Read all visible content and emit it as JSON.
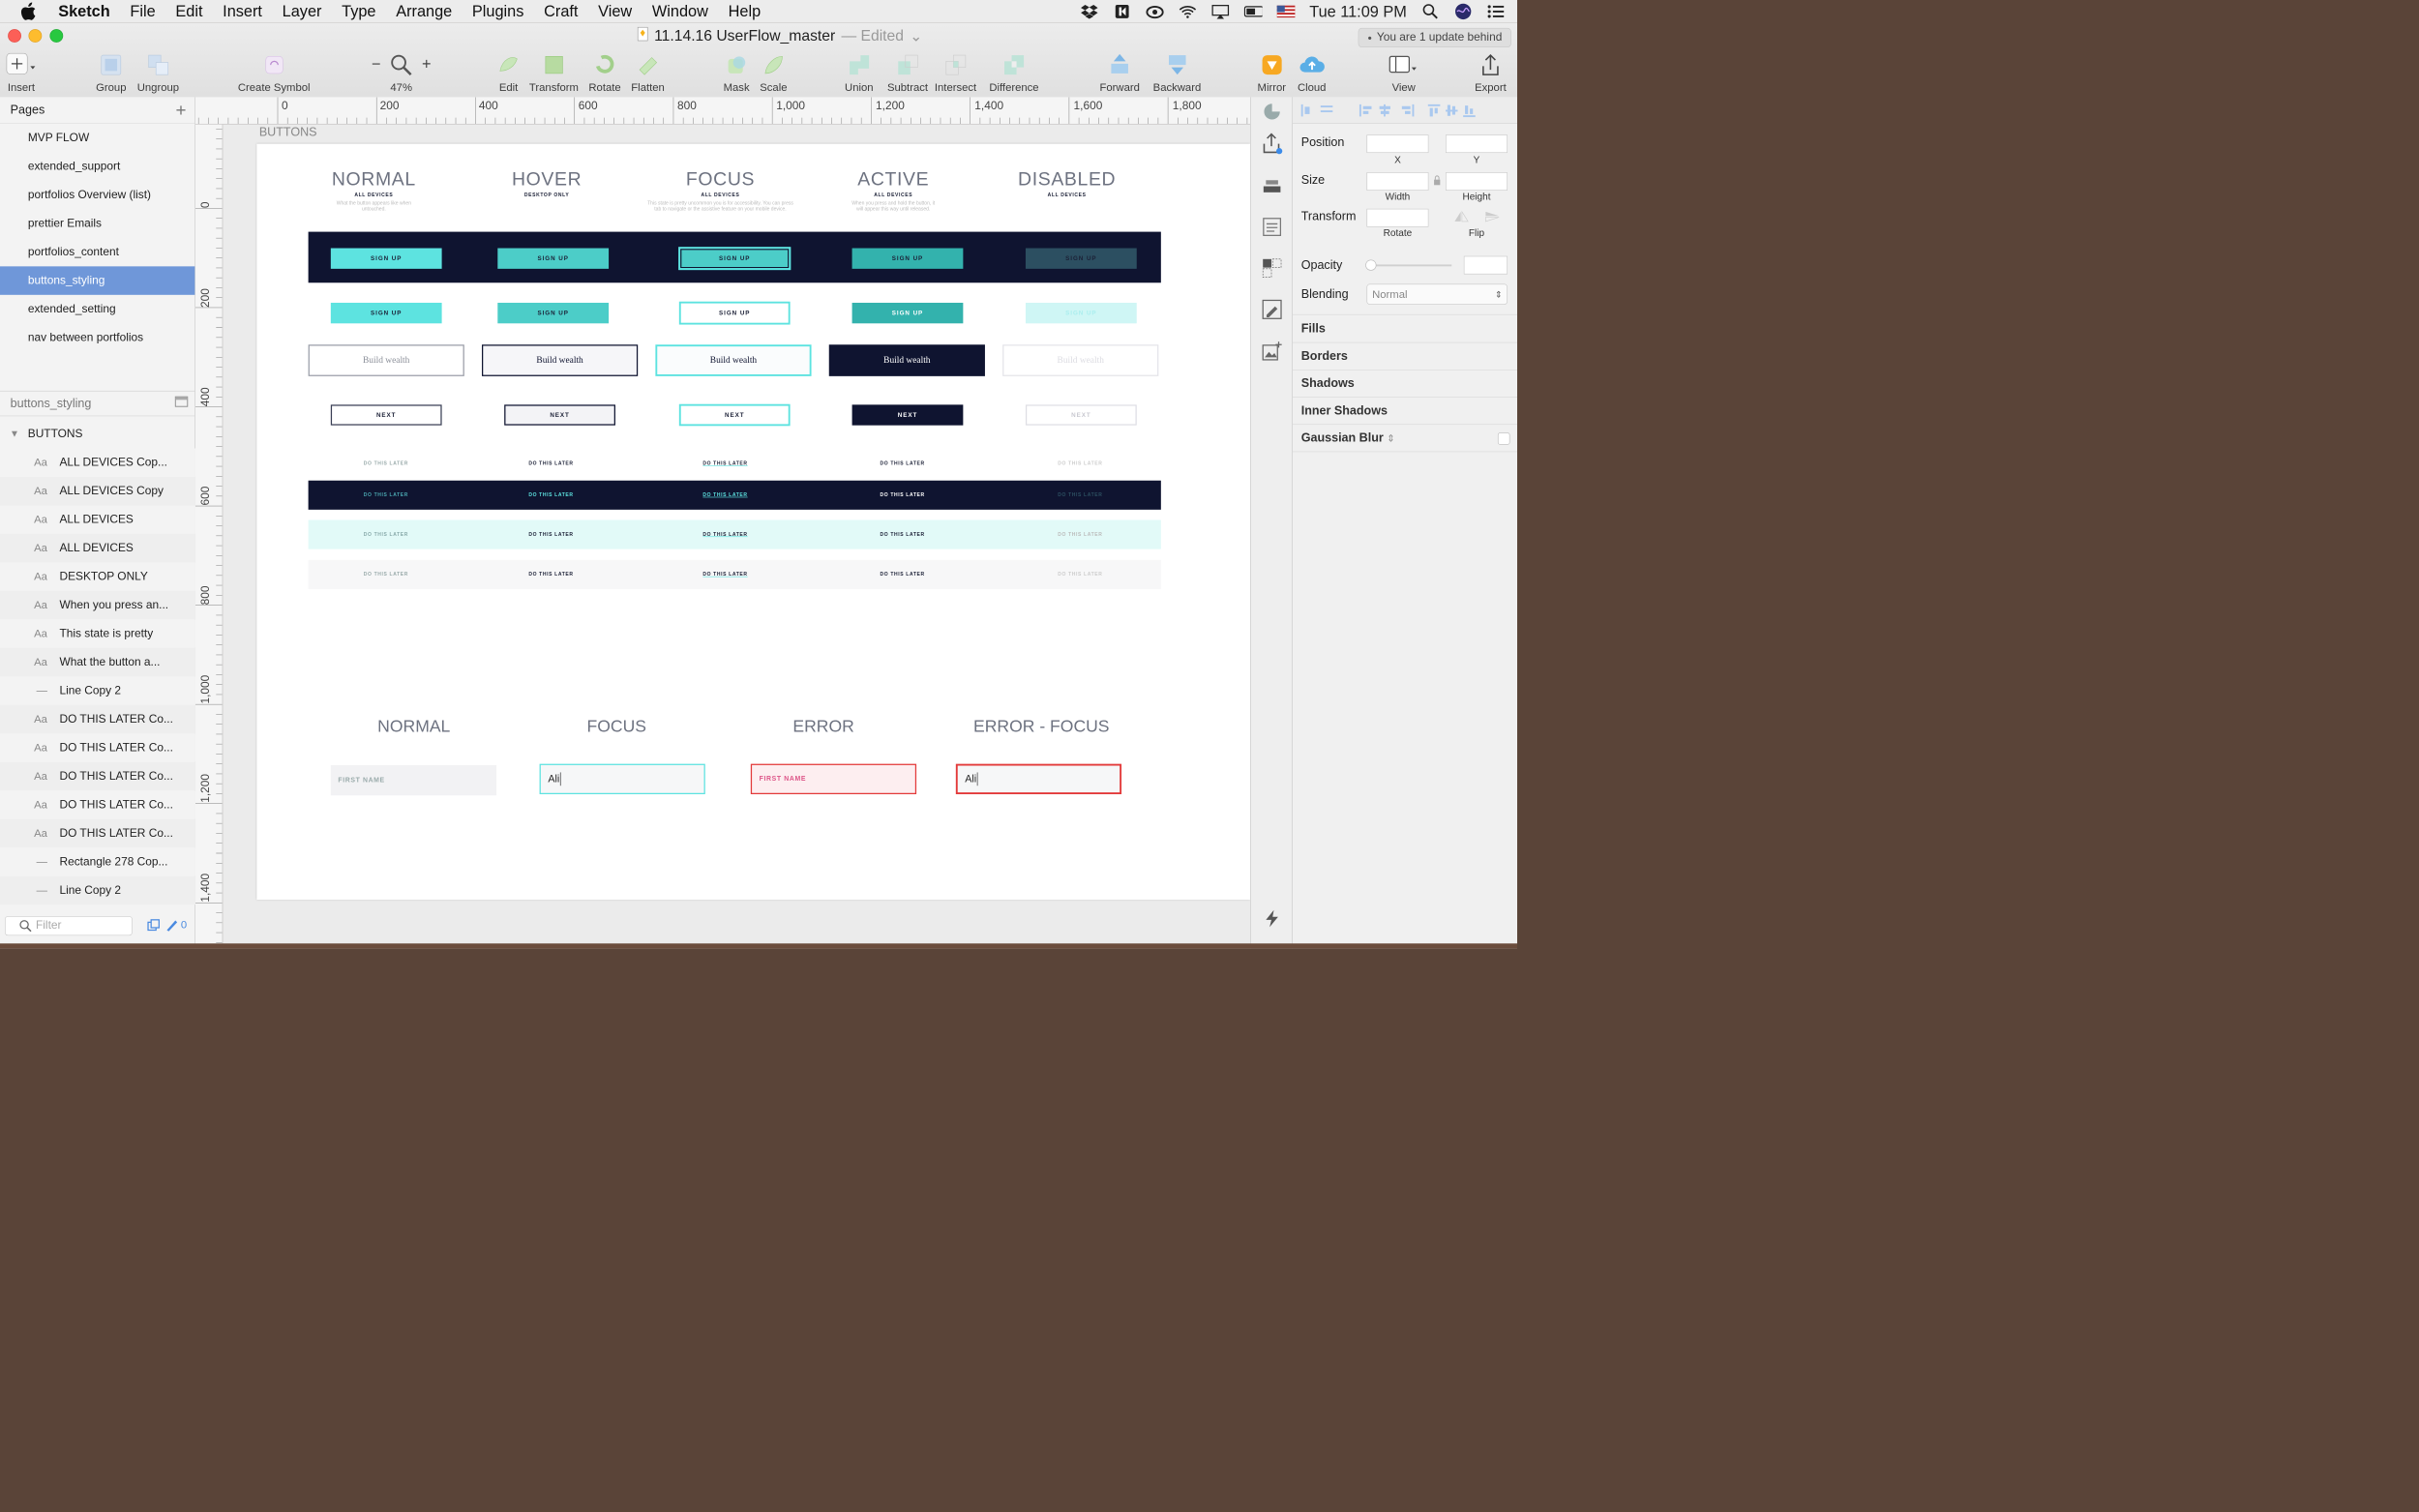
{
  "menubar": {
    "app": "Sketch",
    "items": [
      "File",
      "Edit",
      "Insert",
      "Layer",
      "Type",
      "Arrange",
      "Plugins",
      "Craft",
      "View",
      "Window",
      "Help"
    ],
    "clock": "Tue 11:09 PM"
  },
  "window": {
    "title": "11.14.16 UserFlow_master",
    "edited": "— Edited",
    "update_notice": "You are 1 update behind"
  },
  "toolbar": {
    "insert": "Insert",
    "group": "Group",
    "ungroup": "Ungroup",
    "create_symbol": "Create Symbol",
    "zoom": "47%",
    "edit": "Edit",
    "transform": "Transform",
    "rotate": "Rotate",
    "flatten": "Flatten",
    "mask": "Mask",
    "scale": "Scale",
    "union": "Union",
    "subtract": "Subtract",
    "intersect": "Intersect",
    "difference": "Difference",
    "forward": "Forward",
    "backward": "Backward",
    "mirror": "Mirror",
    "cloud": "Cloud",
    "view": "View",
    "export": "Export"
  },
  "pages": {
    "header": "Pages",
    "items": [
      "MVP FLOW",
      "extended_support",
      "portfolios Overview (list)",
      "prettier Emails",
      "portfolios_content",
      "buttons_styling",
      "extended_setting",
      "nav between portfolios"
    ],
    "selected_index": 5
  },
  "layers": {
    "page_name": "buttons_styling",
    "group": "BUTTONS",
    "items": [
      {
        "type": "text",
        "name": "ALL DEVICES Cop..."
      },
      {
        "type": "text",
        "name": "ALL DEVICES Copy"
      },
      {
        "type": "text",
        "name": "ALL DEVICES"
      },
      {
        "type": "text",
        "name": "ALL DEVICES"
      },
      {
        "type": "text",
        "name": "DESKTOP ONLY"
      },
      {
        "type": "text",
        "name": "When you press an..."
      },
      {
        "type": "text",
        "name": "This state is pretty"
      },
      {
        "type": "text",
        "name": "What the button a..."
      },
      {
        "type": "line",
        "name": "Line Copy 2"
      },
      {
        "type": "text",
        "name": "DO THIS LATER Co..."
      },
      {
        "type": "text",
        "name": "DO THIS LATER Co..."
      },
      {
        "type": "text",
        "name": "DO THIS LATER Co..."
      },
      {
        "type": "text",
        "name": "DO THIS LATER Co..."
      },
      {
        "type": "text",
        "name": "DO THIS LATER Co..."
      },
      {
        "type": "line",
        "name": "Rectangle 278 Cop..."
      },
      {
        "type": "line",
        "name": "Line Copy 2"
      }
    ],
    "filter_placeholder": "Filter",
    "count": "0"
  },
  "rulers": {
    "top": [
      "0",
      "200",
      "400",
      "600",
      "800",
      "1,000",
      "1,200",
      "1,400",
      "1,600",
      "1,800"
    ],
    "left": [
      "0",
      "200",
      "400",
      "600",
      "800",
      "1,000",
      "1,200",
      "1,400"
    ]
  },
  "artboard": {
    "label": "BUTTONS",
    "columns": [
      {
        "title": "NORMAL",
        "sub": "ALL DEVICES",
        "desc": "What the button appears like when untouched."
      },
      {
        "title": "HOVER",
        "sub": "DESKTOP ONLY",
        "desc": ""
      },
      {
        "title": "FOCUS",
        "sub": "ALL DEVICES",
        "desc": "This state is pretty uncommon you is for accessibility. You can press tab to navigate or the assistive feature on your mobile device."
      },
      {
        "title": "ACTIVE",
        "sub": "ALL DEVICES",
        "desc": "When you press and hold the button, it will appear this way until released."
      },
      {
        "title": "DISABLED",
        "sub": "ALL DEVICES",
        "desc": ""
      }
    ],
    "signup": "SIGN UP",
    "build": "Build wealth",
    "next": "NEXT",
    "later": "DO THIS LATER",
    "field_columns": [
      "NORMAL",
      "FOCUS",
      "ERROR",
      "ERROR - FOCUS"
    ],
    "field_placeholder": "FIRST NAME",
    "field_value": "Ali"
  },
  "inspector": {
    "position": "Position",
    "x": "X",
    "y": "Y",
    "size": "Size",
    "width": "Width",
    "height": "Height",
    "transform": "Transform",
    "rotate": "Rotate",
    "flip": "Flip",
    "opacity": "Opacity",
    "blending": "Blending",
    "blending_value": "Normal",
    "fills": "Fills",
    "borders": "Borders",
    "shadows": "Shadows",
    "inner_shadows": "Inner Shadows",
    "gaussian_blur": "Gaussian Blur"
  },
  "colors": {
    "navy": "#0f1430",
    "teal": "#5de3e0",
    "selection": "#6f97d9",
    "error": "#e33a3a"
  }
}
